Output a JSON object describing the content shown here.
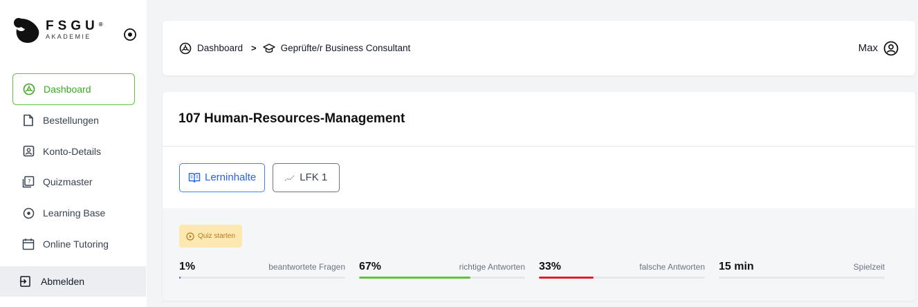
{
  "brand": {
    "name": "FSGU",
    "reg": "®",
    "sub": "AKADEMIE"
  },
  "sidebar": {
    "items": [
      {
        "label": "Dashboard",
        "icon": "dashboard-icon",
        "active": true
      },
      {
        "label": "Bestellungen",
        "icon": "file-icon"
      },
      {
        "label": "Konto-Details",
        "icon": "account-icon"
      },
      {
        "label": "Quizmaster",
        "icon": "quiz-icon"
      },
      {
        "label": "Learning Base",
        "icon": "target-icon"
      },
      {
        "label": "Online Tutoring",
        "icon": "calendar-icon"
      }
    ],
    "logout": "Abmelden"
  },
  "header": {
    "breadcrumb": [
      "Dashboard",
      "Geprüfte/r Business Consultant"
    ],
    "separator": ">",
    "user": "Max"
  },
  "main": {
    "title": "107 Human-Resources-Management",
    "tabs": [
      {
        "label": "Lerninhalte",
        "active": true
      },
      {
        "label": "LFK 1",
        "active": false
      }
    ],
    "quiz_button": "Quiz starten",
    "stats": [
      {
        "value": "1%",
        "label": "beantwortete Fragen",
        "fill": 0.01,
        "color": "#2563eb"
      },
      {
        "value": "67%",
        "label": "richtige Antworten",
        "fill": 0.67,
        "color": "#5ec23f"
      },
      {
        "value": "33%",
        "label": "falsche Antworten",
        "fill": 0.33,
        "color": "#e11d2a"
      },
      {
        "value": "15 min",
        "label": "Spielzeit",
        "fill": 0,
        "color": "#9ca3af"
      }
    ]
  },
  "colors": {
    "accent_green": "#5ec23f",
    "accent_blue": "#2563eb",
    "quiz_bg": "#fde9b0",
    "quiz_text": "#b7791f"
  }
}
